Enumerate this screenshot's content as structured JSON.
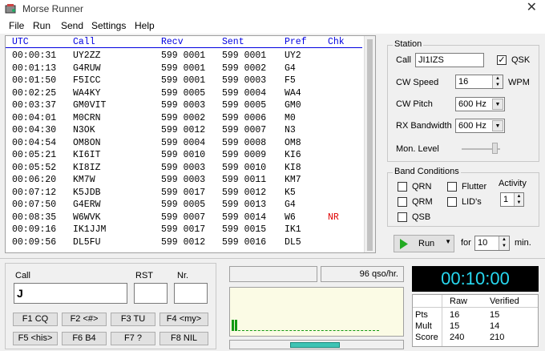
{
  "window": {
    "title": "Morse Runner",
    "close_glyph": "✕"
  },
  "menu": [
    "File",
    "Run",
    "Send",
    "Settings",
    "Help"
  ],
  "log": {
    "headers": {
      "utc": "UTC",
      "call": "Call",
      "recv": "Recv",
      "sent": "Sent",
      "pref": "Pref",
      "chk": "Chk"
    },
    "rows": [
      {
        "utc": "00:00:31",
        "call": "UY2ZZ",
        "recv": "599 0001",
        "sent": "599 0001",
        "pref": "UY2",
        "chk": ""
      },
      {
        "utc": "00:01:13",
        "call": "G4RUW",
        "recv": "599 0001",
        "sent": "599 0002",
        "pref": "G4",
        "chk": ""
      },
      {
        "utc": "00:01:50",
        "call": "F5ICC",
        "recv": "599 0001",
        "sent": "599 0003",
        "pref": "F5",
        "chk": ""
      },
      {
        "utc": "00:02:25",
        "call": "WA4KY",
        "recv": "599 0005",
        "sent": "599 0004",
        "pref": "WA4",
        "chk": ""
      },
      {
        "utc": "00:03:37",
        "call": "GM0VIT",
        "recv": "599 0003",
        "sent": "599 0005",
        "pref": "GM0",
        "chk": ""
      },
      {
        "utc": "00:04:01",
        "call": "M0CRN",
        "recv": "599 0002",
        "sent": "599 0006",
        "pref": "M0",
        "chk": ""
      },
      {
        "utc": "00:04:30",
        "call": "N3OK",
        "recv": "599 0012",
        "sent": "599 0007",
        "pref": "N3",
        "chk": ""
      },
      {
        "utc": "00:04:54",
        "call": "OM8ON",
        "recv": "599 0004",
        "sent": "599 0008",
        "pref": "OM8",
        "chk": ""
      },
      {
        "utc": "00:05:21",
        "call": "KI6IT",
        "recv": "599 0010",
        "sent": "599 0009",
        "pref": "KI6",
        "chk": ""
      },
      {
        "utc": "00:05:52",
        "call": "KI8IZ",
        "recv": "599 0003",
        "sent": "599 0010",
        "pref": "KI8",
        "chk": ""
      },
      {
        "utc": "00:06:20",
        "call": "KM7W",
        "recv": "599 0003",
        "sent": "599 0011",
        "pref": "KM7",
        "chk": ""
      },
      {
        "utc": "00:07:12",
        "call": "K5JDB",
        "recv": "599 0017",
        "sent": "599 0012",
        "pref": "K5",
        "chk": ""
      },
      {
        "utc": "00:07:50",
        "call": "G4ERW",
        "recv": "599 0005",
        "sent": "599 0013",
        "pref": "G4",
        "chk": ""
      },
      {
        "utc": "00:08:35",
        "call": "W6WVK",
        "recv": "599 0007",
        "sent": "599 0014",
        "pref": "W6",
        "chk": "NR"
      },
      {
        "utc": "00:09:16",
        "call": "IK1JJM",
        "recv": "599 0017",
        "sent": "599 0015",
        "pref": "IK1",
        "chk": ""
      },
      {
        "utc": "00:09:56",
        "call": "DL5FU",
        "recv": "599 0012",
        "sent": "599 0016",
        "pref": "DL5",
        "chk": ""
      }
    ]
  },
  "station": {
    "legend": "Station",
    "call_label": "Call",
    "call_value": "JI1IZS",
    "qsk_label": "QSK",
    "qsk_checked": true,
    "cw_speed_label": "CW Speed",
    "cw_speed_value": "16",
    "wpm_label": "WPM",
    "cw_pitch_label": "CW Pitch",
    "cw_pitch_value": "600 Hz",
    "rx_bw_label": "RX Bandwidth",
    "rx_bw_value": "600 Hz",
    "mon_level_label": "Mon. Level"
  },
  "band": {
    "legend": "Band Conditions",
    "qrn": "QRN",
    "qrm": "QRM",
    "qsb": "QSB",
    "flutter": "Flutter",
    "lids": "LID's",
    "activity_label": "Activity",
    "activity_value": "1"
  },
  "run": {
    "label": "Run",
    "for_label": "for",
    "minutes": "10",
    "min_label": "min."
  },
  "entry": {
    "call_label": "Call",
    "call_value": "J",
    "rst_label": "RST",
    "rst_value": "",
    "nr_label": "Nr.",
    "nr_value": ""
  },
  "fkeys": [
    "F1 CQ",
    "F2 <#>",
    "F3 TU",
    "F4 <my>",
    "F5 <his>",
    "F6 B4",
    "F7 ?",
    "F8 NIL"
  ],
  "rate": {
    "value": "96 qso/hr."
  },
  "timer": "00:10:00",
  "score": {
    "col_raw": "Raw",
    "col_verified": "Verified",
    "rows": [
      {
        "label": "Pts",
        "raw": "16",
        "verified": "15"
      },
      {
        "label": "Mult",
        "raw": "15",
        "verified": "14"
      },
      {
        "label": "Score",
        "raw": "240",
        "verified": "210"
      }
    ]
  }
}
